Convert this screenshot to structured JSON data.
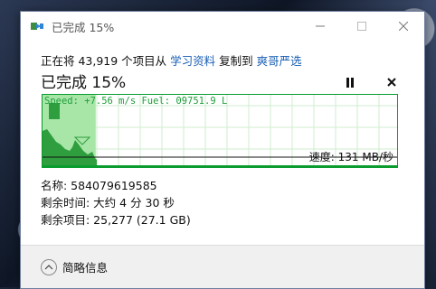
{
  "window": {
    "title": "已完成 15%",
    "icons": {
      "app": "copy-arrow-icon",
      "minimize": "minimize-icon",
      "maximize": "maximize-icon",
      "close": "close-icon"
    }
  },
  "operation": {
    "prefix": "正在将 43,919 个项目从 ",
    "source": "学习资料",
    "middle": " 复制到 ",
    "destination": "爽哥严选",
    "status": "已完成 15%",
    "progress_fraction": 0.15
  },
  "controls": {
    "pause_icon": "pause-icon",
    "cancel_icon": "cancel-icon"
  },
  "graph": {
    "overlay": "Speed: +7.56 m/s Fuel: 09751.9 L",
    "speed_label": "速度: 131 MB/秒",
    "color": "#1f9e3a",
    "fill_color": "#a8e6a8"
  },
  "details": {
    "name": "名称: 584079619585",
    "time_remaining": "剩余时间: 大约 4 分 30 秒",
    "items_remaining": "剩余项目: 25,277 (27.1 GB)"
  },
  "footer": {
    "toggle_label": "简略信息",
    "toggle_icon": "chevron-up-icon"
  }
}
